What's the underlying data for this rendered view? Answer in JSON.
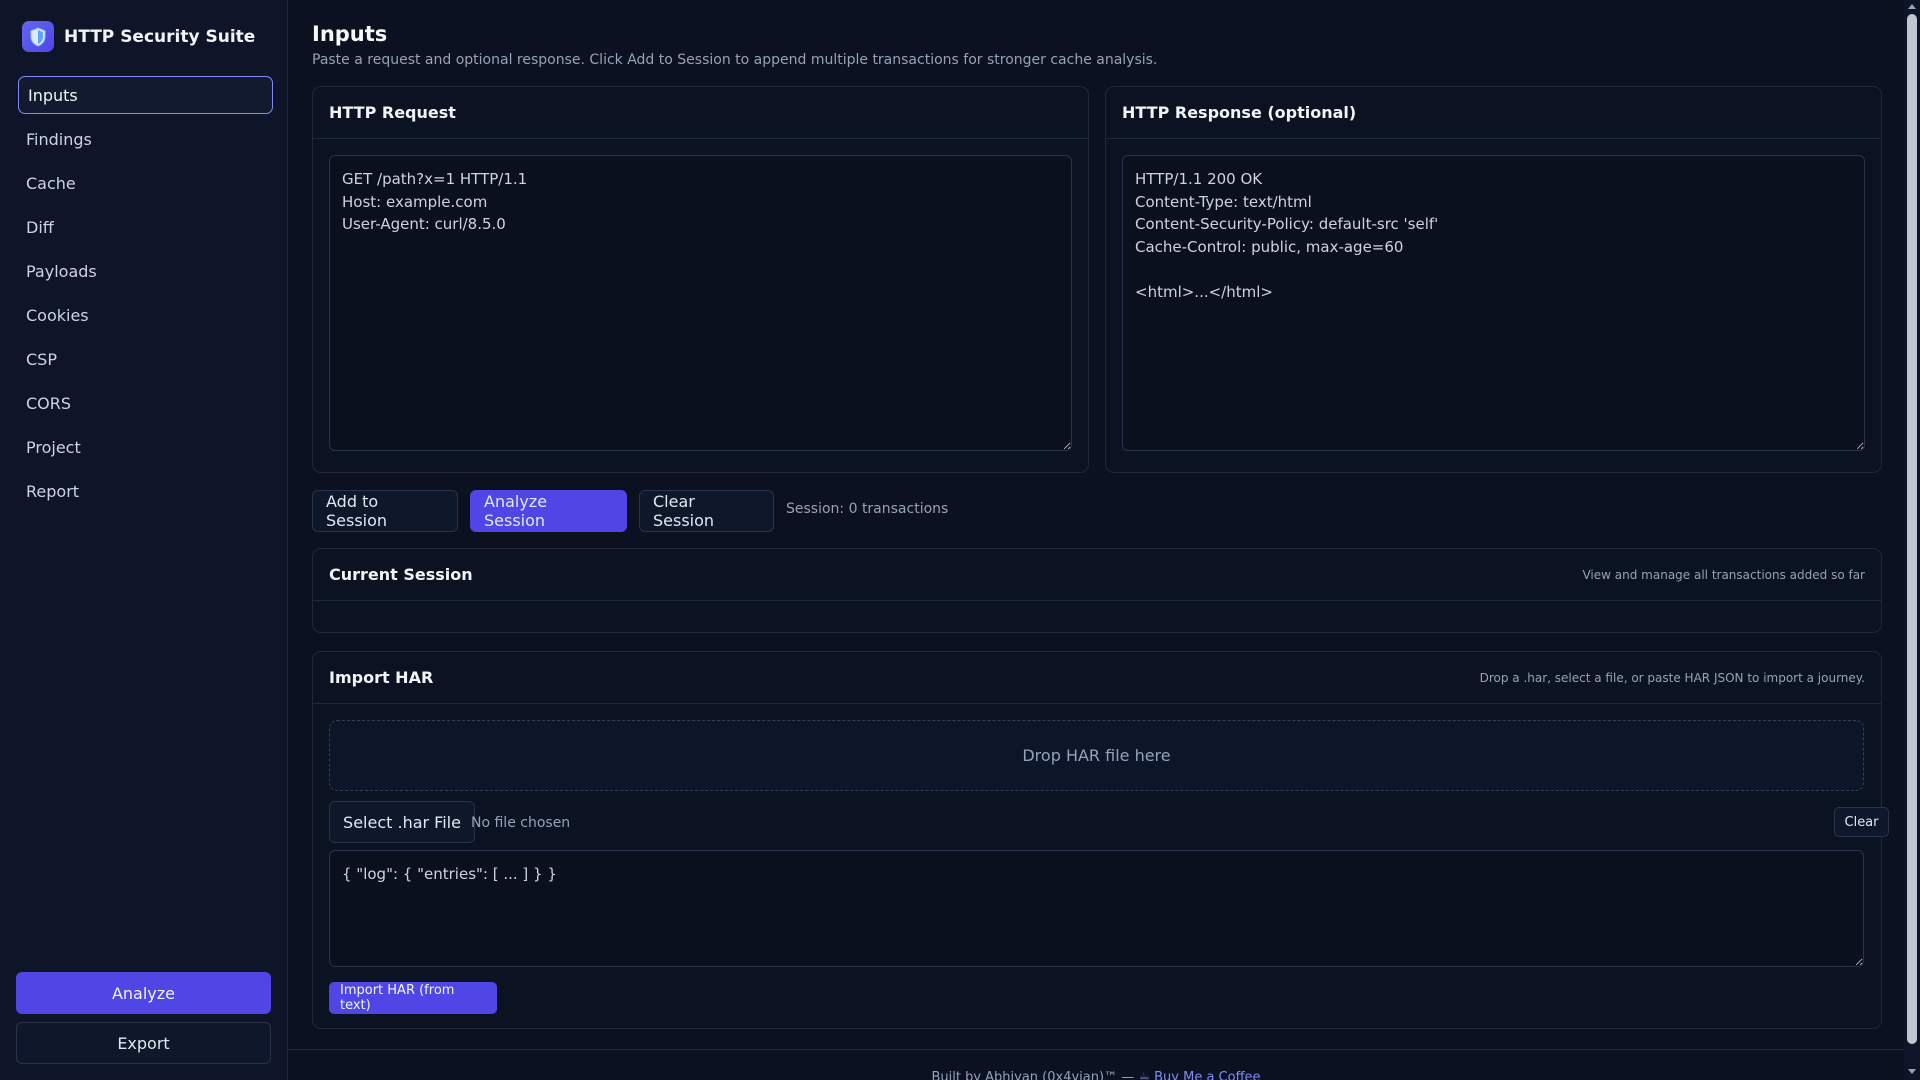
{
  "app": {
    "title": "HTTP Security Suite",
    "logo_icon": "shield-icon"
  },
  "sidebar": {
    "items": [
      {
        "label": "Inputs",
        "active": true
      },
      {
        "label": "Findings"
      },
      {
        "label": "Cache"
      },
      {
        "label": "Diff"
      },
      {
        "label": "Payloads"
      },
      {
        "label": "Cookies"
      },
      {
        "label": "CSP"
      },
      {
        "label": "CORS"
      },
      {
        "label": "Project"
      },
      {
        "label": "Report"
      }
    ],
    "analyze_label": "Analyze",
    "export_label": "Export"
  },
  "page": {
    "title": "Inputs",
    "subtitle": "Paste a request and optional response. Click Add to Session to append multiple transactions for stronger cache analysis."
  },
  "request": {
    "title": "HTTP Request",
    "value": "GET /path?x=1 HTTP/1.1\nHost: example.com\nUser-Agent: curl/8.5.0"
  },
  "response": {
    "title": "HTTP Response (optional)",
    "value": "HTTP/1.1 200 OK\nContent-Type: text/html\nContent-Security-Policy: default-src 'self'\nCache-Control: public, max-age=60\n\n<html>...</html>"
  },
  "session": {
    "add_label": "Add to Session",
    "analyze_label": "Analyze Session",
    "clear_label": "Clear Session",
    "status": "Session: 0 transactions",
    "current_title": "Current Session",
    "current_hint": "View and manage all transactions added so far"
  },
  "har": {
    "title": "Import HAR",
    "hint": "Drop a .har, select a file, or paste HAR JSON to import a journey.",
    "drop_label": "Drop HAR file here",
    "select_label": "Select .har File",
    "file_status": "No file chosen",
    "clear_label": "Clear",
    "text_value": "{ \"log\": { \"entries\": [ ... ] } }",
    "import_label": "Import HAR (from text)"
  },
  "footer": {
    "text": "Built by Abhiyan (0x4yian)™ — ",
    "link_label": "Buy Me a Coffee"
  },
  "colors": {
    "accent": "#4f46e5",
    "background": "#0b1120",
    "active_border": "#818cf8"
  }
}
